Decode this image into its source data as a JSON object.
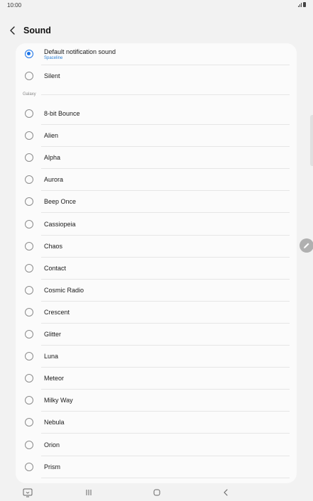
{
  "status": {
    "time": "10:00"
  },
  "header": {
    "title": "Sound"
  },
  "default_item": {
    "label": "Default notification sound",
    "sublabel": "Spaceline",
    "selected": true
  },
  "silent_item": {
    "label": "Silent"
  },
  "section": {
    "label": "Galaxy"
  },
  "sounds": [
    "8-bit Bounce",
    "Alien",
    "Alpha",
    "Aurora",
    "Beep Once",
    "Cassiopeia",
    "Chaos",
    "Contact",
    "Cosmic Radio",
    "Crescent",
    "Glitter",
    "Luna",
    "Meteor",
    "Milky Way",
    "Nebula",
    "Orion",
    "Prism"
  ],
  "colors": {
    "accent": "#1a73e8",
    "sublabel": "#2a7fd4",
    "background": "#f2f2f2",
    "card": "#fbfbfb"
  },
  "icons": {
    "back": "chevron-left-icon",
    "radio": "radio-icon",
    "edit": "pencil-icon",
    "nav_recent_apps": "recent-apps-icon",
    "nav_home": "home-icon",
    "nav_back": "back-icon",
    "nav_keyboard": "keyboard-icon"
  }
}
